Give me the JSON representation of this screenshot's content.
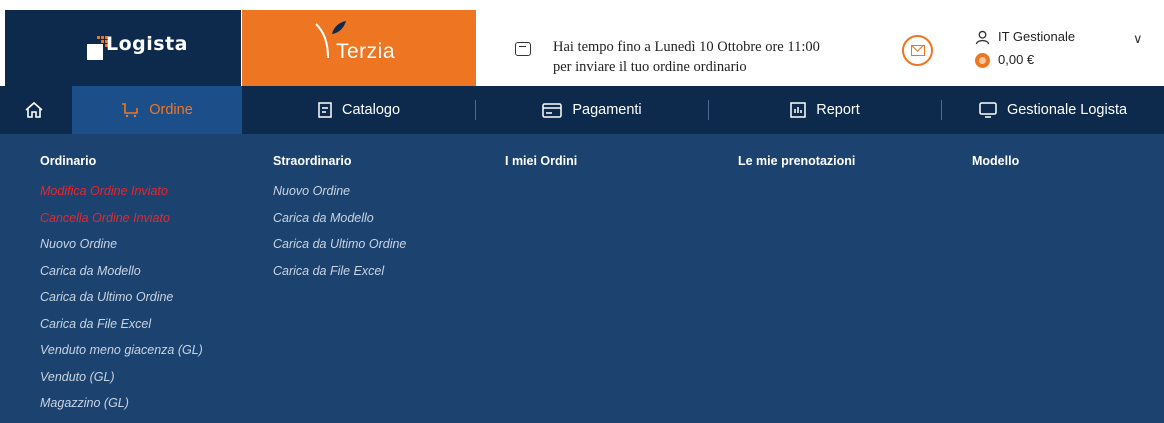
{
  "brand": {
    "logista": "Logista",
    "terzia": "Terzia"
  },
  "notice": {
    "line1": "Hai tempo fino a Lunedì 10 Ottobre ore 11:00",
    "line2": "per inviare il tuo ordine ordinario"
  },
  "user": {
    "name": "IT Gestionale",
    "balance": "0,00 €"
  },
  "nav": {
    "ordine": "Ordine",
    "catalogo": "Catalogo",
    "pagamenti": "Pagamenti",
    "report": "Report",
    "gestionale": "Gestionale Logista"
  },
  "menu": {
    "ordinario": {
      "title": "Ordinario",
      "items": [
        "Modifica Ordine Inviato",
        "Cancella Ordine Inviato",
        "Nuovo Ordine",
        "Carica da Modello",
        "Carica da Ultimo Ordine",
        "Carica da File Excel",
        "Venduto meno giacenza (GL)",
        "Venduto (GL)",
        "Magazzino (GL)"
      ]
    },
    "straordinario": {
      "title": "Straordinario",
      "items": [
        "Nuovo Ordine",
        "Carica da Modello",
        "Carica da Ultimo Ordine",
        "Carica da File Excel"
      ]
    },
    "miei_ordini": {
      "title": "I miei Ordini"
    },
    "prenotazioni": {
      "title": "Le mie prenotazioni"
    },
    "modello": {
      "title": "Modello"
    }
  },
  "colors": {
    "navy": "#0d2a4d",
    "panel": "#1c4370",
    "active_tab": "#1c4f8a",
    "orange": "#ee7622",
    "alert_red": "#e8262d"
  },
  "icons": [
    "home-icon",
    "cart-icon",
    "catalog-icon",
    "payment-card-icon",
    "report-icon",
    "monitor-icon",
    "chat-icon",
    "mail-icon",
    "person-icon",
    "coin-icon",
    "chevron-down-icon"
  ]
}
